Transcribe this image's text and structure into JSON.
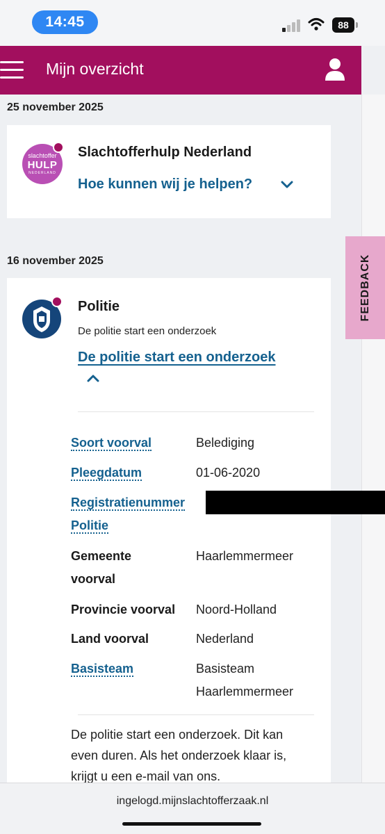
{
  "status_bar": {
    "time": "14:45",
    "battery": "88"
  },
  "app_bar": {
    "title": "Mijn overzicht"
  },
  "colors": {
    "brand": "#a20f5e",
    "link": "#15618f",
    "feedback_tab": "#e7a8cc"
  },
  "timeline": [
    {
      "date": "25 november 2025",
      "org": "Slachtofferhulp Nederland",
      "logo_text": {
        "line1": "slachtoffer",
        "line2": "HULP",
        "line3": "NEDERLAND"
      },
      "link": "Hoe kunnen wij je helpen?"
    },
    {
      "date": "16 november 2025",
      "org": "Politie",
      "subtitle": "De politie start een onderzoek",
      "link": "De politie start een onderzoek",
      "details": [
        {
          "label": "Soort voorval",
          "value": "Belediging"
        },
        {
          "label": "Pleegdatum",
          "value": "01-06-2020"
        },
        {
          "label_line1": "Registratienummer",
          "label_line2": "Politie",
          "value": ""
        },
        {
          "label_line1": "Gemeente",
          "label_line2": "voorval",
          "value": "Haarlemmermeer"
        },
        {
          "label": "Provincie voorval",
          "value": "Noord-Holland"
        },
        {
          "label": "Land voorval",
          "value": "Nederland"
        },
        {
          "label": "Basisteam",
          "value_line1": "Basisteam",
          "value_line2": "Haarlemmermeer"
        }
      ],
      "body_text": "De politie start een onderzoek. Dit kan even duren. Als het onderzoek klaar is, krijgt u een e-mail van ons."
    }
  ],
  "feedback_label": "FEEDBACK",
  "url": "ingelogd.mijnslachtofferzaak.nl"
}
